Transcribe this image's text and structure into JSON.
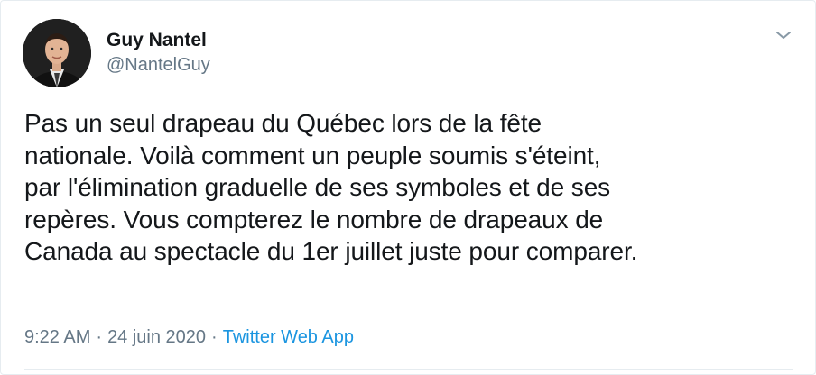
{
  "tweet": {
    "user": {
      "name": "Guy Nantel",
      "handle": "@NantelGuy"
    },
    "text": "Pas un seul drapeau du Québec lors de la fête\nnationale. Voilà comment un peuple soumis s'éteint,\npar l'élimination graduelle de ses symboles et de ses\nrepères. Vous compterez le nombre de drapeaux de\nCanada au spectacle du 1er juillet juste pour comparer.",
    "time": "9:22 AM",
    "separator": "·",
    "date": "24 juin 2020",
    "source": "Twitter Web App"
  },
  "icons": {
    "menu": "chevron-down-icon"
  },
  "colors": {
    "text": "#14171a",
    "secondary": "#657786",
    "link": "#1b95e0",
    "border": "#e6ecf0"
  }
}
